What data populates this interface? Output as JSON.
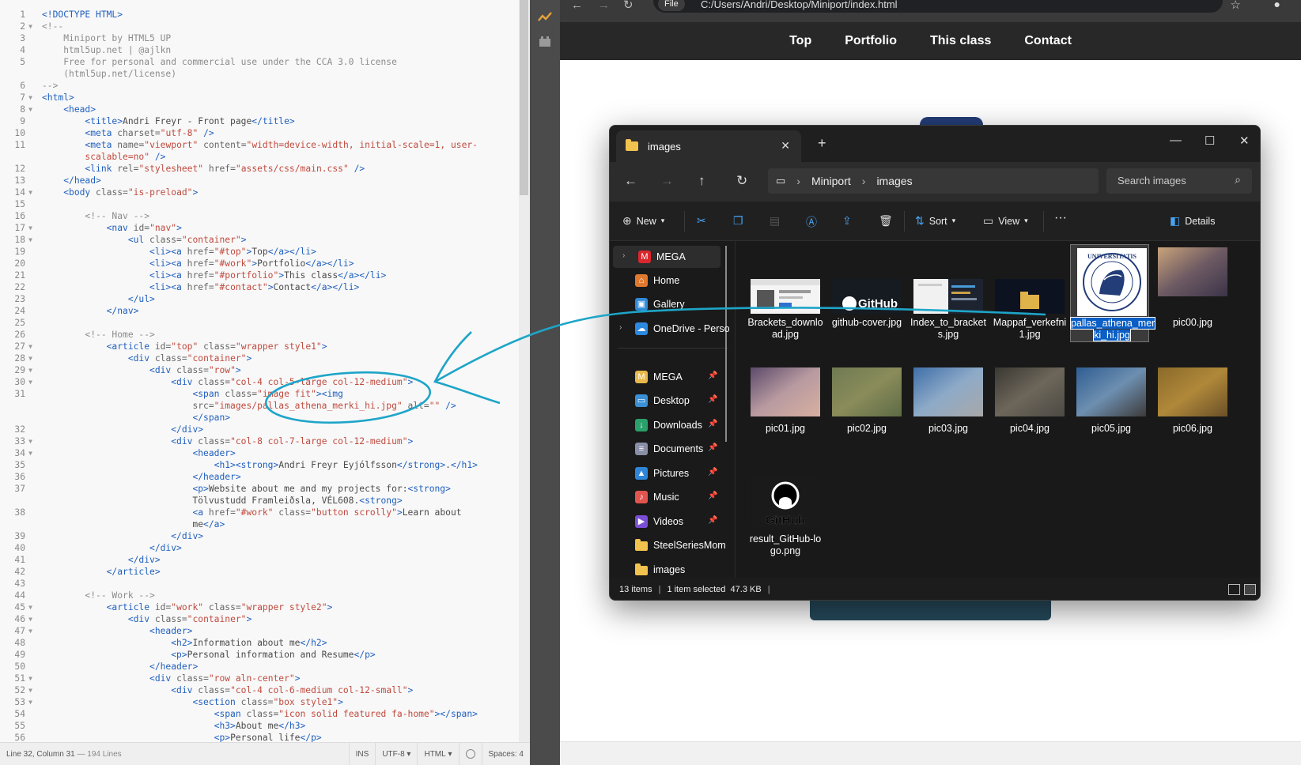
{
  "editor": {
    "lines": [
      {
        "n": "1",
        "f": "",
        "h": "<span class='t'>&lt;!DOCTYPE HTML&gt;</span>"
      },
      {
        "n": "2",
        "f": "▼",
        "h": "<span class='c'>&lt;!--</span>"
      },
      {
        "n": "3",
        "f": "",
        "h": "<span class='c'>    Miniport by HTML5 UP</span>"
      },
      {
        "n": "4",
        "f": "",
        "h": "<span class='c'>    html5up.net | @ajlkn</span>"
      },
      {
        "n": "5",
        "f": "",
        "h": "<span class='c'>    Free for personal and commercial use under the CCA 3.0 license</span>"
      },
      {
        "n": "",
        "f": "",
        "h": "<span class='c'>    (html5up.net/license)</span>"
      },
      {
        "n": "6",
        "f": "",
        "h": "<span class='c'>--&gt;</span>"
      },
      {
        "n": "7",
        "f": "▼",
        "h": "<span class='t'>&lt;html&gt;</span>"
      },
      {
        "n": "8",
        "f": "▼",
        "h": "    <span class='t'>&lt;head&gt;</span>"
      },
      {
        "n": "9",
        "f": "",
        "h": "        <span class='t'>&lt;title&gt;</span>Andri Freyr - Front page<span class='t'>&lt;/title&gt;</span>"
      },
      {
        "n": "10",
        "f": "",
        "h": "        <span class='t'>&lt;meta</span> <span class='a'>charset=</span><span class='s'>\"utf-8\"</span> <span class='t'>/&gt;</span>"
      },
      {
        "n": "11",
        "f": "",
        "h": "        <span class='t'>&lt;meta</span> <span class='a'>name=</span><span class='s'>\"viewport\"</span> <span class='a'>content=</span><span class='s'>\"width=device-width, initial-scale=1, user-</span>"
      },
      {
        "n": "",
        "f": "",
        "h": "        <span class='s'>scalable=no\"</span> <span class='t'>/&gt;</span>"
      },
      {
        "n": "12",
        "f": "",
        "h": "        <span class='t'>&lt;link</span> <span class='a'>rel=</span><span class='s'>\"stylesheet\"</span> <span class='a'>href=</span><span class='s'>\"assets/css/main.css\"</span> <span class='t'>/&gt;</span>"
      },
      {
        "n": "13",
        "f": "",
        "h": "    <span class='t'>&lt;/head&gt;</span>"
      },
      {
        "n": "14",
        "f": "▼",
        "h": "    <span class='t'>&lt;body</span> <span class='a'>class=</span><span class='s'>\"is-preload\"</span><span class='t'>&gt;</span>"
      },
      {
        "n": "15",
        "f": "",
        "h": ""
      },
      {
        "n": "16",
        "f": "",
        "h": "        <span class='c'>&lt;!-- Nav --&gt;</span>"
      },
      {
        "n": "17",
        "f": "▼",
        "h": "            <span class='t'>&lt;nav</span> <span class='a'>id=</span><span class='s'>\"nav\"</span><span class='t'>&gt;</span>"
      },
      {
        "n": "18",
        "f": "▼",
        "h": "                <span class='t'>&lt;ul</span> <span class='a'>class=</span><span class='s'>\"container\"</span><span class='t'>&gt;</span>"
      },
      {
        "n": "19",
        "f": "",
        "h": "                    <span class='t'>&lt;li&gt;&lt;a</span> <span class='a'>href=</span><span class='s'>\"#top\"</span><span class='t'>&gt;</span>Top<span class='t'>&lt;/a&gt;&lt;/li&gt;</span>"
      },
      {
        "n": "20",
        "f": "",
        "h": "                    <span class='t'>&lt;li&gt;&lt;a</span> <span class='a'>href=</span><span class='s'>\"#work\"</span><span class='t'>&gt;</span>Portfolio<span class='t'>&lt;/a&gt;&lt;/li&gt;</span>"
      },
      {
        "n": "21",
        "f": "",
        "h": "                    <span class='t'>&lt;li&gt;&lt;a</span> <span class='a'>href=</span><span class='s'>\"#portfolio\"</span><span class='t'>&gt;</span>This class<span class='t'>&lt;/a&gt;&lt;/li&gt;</span>"
      },
      {
        "n": "22",
        "f": "",
        "h": "                    <span class='t'>&lt;li&gt;&lt;a</span> <span class='a'>href=</span><span class='s'>\"#contact\"</span><span class='t'>&gt;</span>Contact<span class='t'>&lt;/a&gt;&lt;/li&gt;</span>"
      },
      {
        "n": "23",
        "f": "",
        "h": "                <span class='t'>&lt;/ul&gt;</span>"
      },
      {
        "n": "24",
        "f": "",
        "h": "            <span class='t'>&lt;/nav&gt;</span>"
      },
      {
        "n": "25",
        "f": "",
        "h": ""
      },
      {
        "n": "26",
        "f": "",
        "h": "        <span class='c'>&lt;!-- Home --&gt;</span>"
      },
      {
        "n": "27",
        "f": "▼",
        "h": "            <span class='t'>&lt;article</span> <span class='a'>id=</span><span class='s'>\"top\"</span> <span class='a'>class=</span><span class='s'>\"wrapper style1\"</span><span class='t'>&gt;</span>"
      },
      {
        "n": "28",
        "f": "▼",
        "h": "                <span class='t'>&lt;div</span> <span class='a'>class=</span><span class='s'>\"container\"</span><span class='t'>&gt;</span>"
      },
      {
        "n": "29",
        "f": "▼",
        "h": "                    <span class='t'>&lt;div</span> <span class='a'>class=</span><span class='s'>\"row\"</span><span class='t'>&gt;</span>"
      },
      {
        "n": "30",
        "f": "▼",
        "h": "                        <span class='t'>&lt;div</span> <span class='a'>class=</span><span class='s'>\"col-4 col-5-large col-12-medium\"</span><span class='t'>&gt;</span>"
      },
      {
        "n": "31",
        "f": "",
        "h": "                            <span class='t'>&lt;span</span> <span class='a'>class=</span><span class='s'>\"image fit\"</span><span class='t'>&gt;&lt;img</span>"
      },
      {
        "n": "",
        "f": "",
        "h": "                            <span class='a'>src=</span><span class='s'>\"images/pallas_athena_merki_hi.jpg\"</span> <span class='a'>alt=</span><span class='s'>\"\"</span> <span class='t'>/&gt;</span>"
      },
      {
        "n": "",
        "f": "",
        "h": "                            <span class='t'>&lt;/span&gt;</span>"
      },
      {
        "n": "32",
        "f": "",
        "h": "                        <span class='t'>&lt;/div&gt;</span>"
      },
      {
        "n": "33",
        "f": "▼",
        "h": "                        <span class='t'>&lt;div</span> <span class='a'>class=</span><span class='s'>\"col-8 col-7-large col-12-medium\"</span><span class='t'>&gt;</span>"
      },
      {
        "n": "34",
        "f": "▼",
        "h": "                            <span class='t'>&lt;header&gt;</span>"
      },
      {
        "n": "35",
        "f": "",
        "h": "                                <span class='t'>&lt;h1&gt;&lt;strong&gt;</span>Andri Freyr Eyjólfsson<span class='t'>&lt;/strong&gt;</span>.<span class='t'>&lt;/h1&gt;</span>"
      },
      {
        "n": "36",
        "f": "",
        "h": "                            <span class='t'>&lt;/header&gt;</span>"
      },
      {
        "n": "37",
        "f": "",
        "h": "                            <span class='t'>&lt;p&gt;</span>Website about me and my projects for:<span class='t'>&lt;strong&gt;</span>"
      },
      {
        "n": "",
        "f": "",
        "h": "                            Tölvustudd Framleiðsla, VÉL608.<span class='t'>&lt;strong&gt;</span>"
      },
      {
        "n": "38",
        "f": "",
        "h": "                            <span class='t'>&lt;a</span> <span class='a'>href=</span><span class='s'>\"#work\"</span> <span class='a'>class=</span><span class='s'>\"button scrolly\"</span><span class='t'>&gt;</span>Learn about"
      },
      {
        "n": "",
        "f": "",
        "h": "                            me<span class='t'>&lt;/a&gt;</span>"
      },
      {
        "n": "39",
        "f": "",
        "h": "                        <span class='t'>&lt;/div&gt;</span>"
      },
      {
        "n": "40",
        "f": "",
        "h": "                    <span class='t'>&lt;/div&gt;</span>"
      },
      {
        "n": "41",
        "f": "",
        "h": "                <span class='t'>&lt;/div&gt;</span>"
      },
      {
        "n": "42",
        "f": "",
        "h": "            <span class='t'>&lt;/article&gt;</span>"
      },
      {
        "n": "43",
        "f": "",
        "h": ""
      },
      {
        "n": "44",
        "f": "",
        "h": "        <span class='c'>&lt;!-- Work --&gt;</span>"
      },
      {
        "n": "45",
        "f": "▼",
        "h": "            <span class='t'>&lt;article</span> <span class='a'>id=</span><span class='s'>\"work\"</span> <span class='a'>class=</span><span class='s'>\"wrapper style2\"</span><span class='t'>&gt;</span>"
      },
      {
        "n": "46",
        "f": "▼",
        "h": "                <span class='t'>&lt;div</span> <span class='a'>class=</span><span class='s'>\"container\"</span><span class='t'>&gt;</span>"
      },
      {
        "n": "47",
        "f": "▼",
        "h": "                    <span class='t'>&lt;header&gt;</span>"
      },
      {
        "n": "48",
        "f": "",
        "h": "                        <span class='t'>&lt;h2&gt;</span>Information about me<span class='t'>&lt;/h2&gt;</span>"
      },
      {
        "n": "49",
        "f": "",
        "h": "                        <span class='t'>&lt;p&gt;</span>Personal information and Resume<span class='t'>&lt;/p&gt;</span>"
      },
      {
        "n": "50",
        "f": "",
        "h": "                    <span class='t'>&lt;/header&gt;</span>"
      },
      {
        "n": "51",
        "f": "▼",
        "h": "                    <span class='t'>&lt;div</span> <span class='a'>class=</span><span class='s'>\"row aln-center\"</span><span class='t'>&gt;</span>"
      },
      {
        "n": "52",
        "f": "▼",
        "h": "                        <span class='t'>&lt;div</span> <span class='a'>class=</span><span class='s'>\"col-4 col-6-medium col-12-small\"</span><span class='t'>&gt;</span>"
      },
      {
        "n": "53",
        "f": "▼",
        "h": "                            <span class='t'>&lt;section</span> <span class='a'>class=</span><span class='s'>\"box style1\"</span><span class='t'>&gt;</span>"
      },
      {
        "n": "54",
        "f": "",
        "h": "                                <span class='t'>&lt;span</span> <span class='a'>class=</span><span class='s'>\"icon solid featured fa-home\"</span><span class='t'>&gt;&lt;/span&gt;</span>"
      },
      {
        "n": "55",
        "f": "",
        "h": "                                <span class='t'>&lt;h3&gt;</span>About me<span class='t'>&lt;/h3&gt;</span>"
      },
      {
        "n": "56",
        "f": "",
        "h": "                                <span class='t'>&lt;p&gt;</span>Personal life<span class='t'>&lt;/p&gt;</span>"
      }
    ],
    "status": {
      "position": "Line 32, Column 31",
      "lines": "— 194 Lines",
      "mode": "INS",
      "encoding": "UTF-8",
      "language": "HTML",
      "spaces": "Spaces: 4"
    }
  },
  "browser": {
    "url_chip": "File",
    "url": "C:/Users/Andri/Desktop/Miniport/index.html",
    "nav": [
      "Top",
      "Portfolio",
      "This class",
      "Contact"
    ]
  },
  "explorer": {
    "tab_title": "images",
    "breadcrumb": [
      "Miniport",
      "images"
    ],
    "search_placeholder": "Search images",
    "commands": {
      "new": "New",
      "sort": "Sort",
      "view": "View",
      "details": "Details",
      "more": "···"
    },
    "sidebar": [
      {
        "label": "MEGA",
        "icon": "mega-icon",
        "color": "#d9272e",
        "glyph": "M",
        "chev": true,
        "pin": false,
        "sel": true
      },
      {
        "label": "Home",
        "icon": "home-icon",
        "color": "#e0792e",
        "glyph": "⌂",
        "chev": false,
        "pin": false
      },
      {
        "label": "Gallery",
        "icon": "gallery-icon",
        "color": "#2f8ad8",
        "glyph": "▣",
        "chev": false,
        "pin": false
      },
      {
        "label": "OneDrive - Perso",
        "icon": "onedrive-icon",
        "color": "#2d88e0",
        "glyph": "☁",
        "chev": true,
        "pin": false
      },
      {
        "label": "MEGA",
        "icon": "mega-folder-icon",
        "color": "#e7b84a",
        "glyph": "M",
        "chev": false,
        "pin": true
      },
      {
        "label": "Desktop",
        "icon": "desktop-icon",
        "color": "#3a8fd6",
        "glyph": "▭",
        "chev": false,
        "pin": true
      },
      {
        "label": "Downloads",
        "icon": "downloads-icon",
        "color": "#2aa06a",
        "glyph": "↓",
        "chev": false,
        "pin": true
      },
      {
        "label": "Documents",
        "icon": "documents-icon",
        "color": "#8a8fa8",
        "glyph": "≡",
        "chev": false,
        "pin": true
      },
      {
        "label": "Pictures",
        "icon": "pictures-icon",
        "color": "#2f86d8",
        "glyph": "▲",
        "chev": false,
        "pin": true
      },
      {
        "label": "Music",
        "icon": "music-icon",
        "color": "#e2554f",
        "glyph": "♪",
        "chev": false,
        "pin": true
      },
      {
        "label": "Videos",
        "icon": "videos-icon",
        "color": "#7a4fd6",
        "glyph": "▶",
        "chev": false,
        "pin": true
      },
      {
        "label": "SteelSeriesMom",
        "icon": "folder-icon",
        "color": "#f2c24f",
        "glyph": "",
        "chev": false,
        "pin": false
      },
      {
        "label": "images",
        "icon": "folder-icon",
        "color": "#f2c24f",
        "glyph": "",
        "chev": false,
        "pin": false
      }
    ],
    "files": [
      {
        "name": "Brackets_downlo ad.jpg",
        "thumb": "brackets"
      },
      {
        "name": "github-cover.jpg",
        "thumb": "githubcover"
      },
      {
        "name": "Index_to_bracket s.jpg",
        "thumb": "index"
      },
      {
        "name": "Mappaf_verkefni 1.jpg",
        "thumb": "mappa"
      },
      {
        "name": "pallas_athena_mer ki_hi.jpg",
        "thumb": "pallas",
        "selected": true
      },
      {
        "name": "pic00.jpg",
        "thumb": "p00"
      },
      {
        "name": "pic01.jpg",
        "thumb": "p01"
      },
      {
        "name": "pic02.jpg",
        "thumb": "p02"
      },
      {
        "name": "pic03.jpg",
        "thumb": "p03"
      },
      {
        "name": "pic04.jpg",
        "thumb": "p04"
      },
      {
        "name": "pic05.jpg",
        "thumb": "p05"
      },
      {
        "name": "pic06.jpg",
        "thumb": "p06"
      },
      {
        "name": "result_GitHub-lo go.png",
        "thumb": "ghlogo"
      }
    ],
    "github_word": "GitHub",
    "seal_text": "UNIVERSITATIS ISLANDIAE SIGILLUM",
    "status": {
      "count": "13 items",
      "selected": "1 item selected",
      "size": "47.3 KB"
    }
  },
  "colors": {
    "annotation": "#1ea5c8",
    "selection": "#0a5ec5"
  }
}
